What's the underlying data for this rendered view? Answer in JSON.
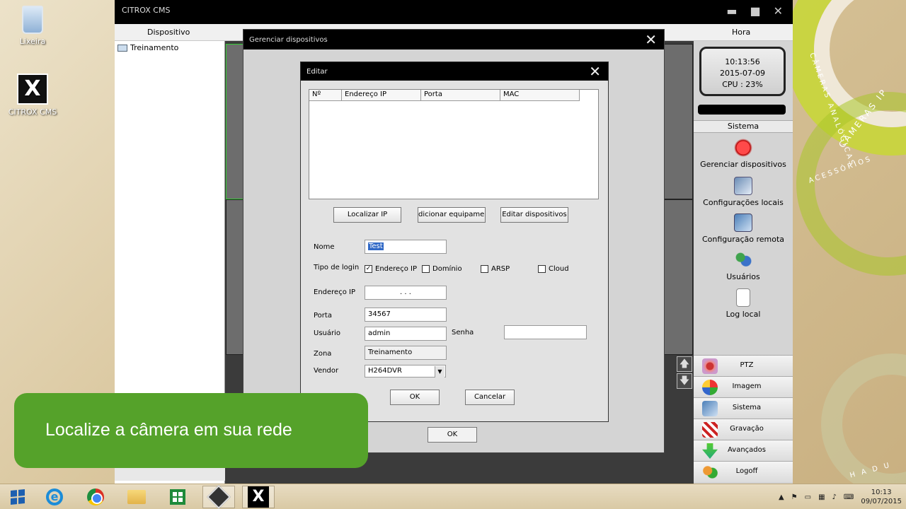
{
  "desktop": {
    "icons": [
      {
        "label": "Lixeira"
      },
      {
        "label": "CITROX CMS"
      }
    ],
    "deco_texts": [
      "CÂMERAS IP",
      "CÂMERAS ANALÓGICAS",
      "ACESSÓRIOS",
      "H A D U"
    ]
  },
  "cms": {
    "title": "CITROX CMS",
    "header_device": "Dispositivo",
    "header_time": "Hora",
    "tree_item": "Treinamento",
    "clock": {
      "time": "10:13:56",
      "date": "2015-07-09",
      "cpu": "CPU : 23%"
    },
    "system_header": "Sistema",
    "system_items": [
      {
        "label": "Gerenciar dispositivos",
        "icon": "record-red-icon"
      },
      {
        "label": "Configurações locais",
        "icon": "tools-icon"
      },
      {
        "label": "Configuração remota",
        "icon": "remote-config-icon"
      },
      {
        "label": "Usuários",
        "icon": "users-icon"
      },
      {
        "label": "Log local",
        "icon": "log-document-icon"
      }
    ],
    "bottom_menu": [
      {
        "label": "PTZ",
        "icon": "ptz-icon"
      },
      {
        "label": "Imagem",
        "icon": "image-icon"
      },
      {
        "label": "Sistema",
        "icon": "system-icon"
      },
      {
        "label": "Gravação",
        "icon": "clapper-icon"
      },
      {
        "label": "Avançados",
        "icon": "advanced-icon"
      },
      {
        "label": "Logoff",
        "icon": "logoff-icon"
      }
    ],
    "scroll_up": "🡅",
    "scroll_down": "🡇"
  },
  "gerenciar": {
    "title": "Gerenciar dispositivos",
    "ok_label": "OK"
  },
  "editar": {
    "title": "Editar",
    "columns": [
      "Nº",
      "Endereço IP",
      "Porta",
      "MAC"
    ],
    "buttons": {
      "localizar": "Localizar IP",
      "adicionar": "dicionar equipament",
      "editar": "Editar dispositivos",
      "ok": "OK",
      "cancelar": "Cancelar"
    },
    "labels": {
      "nome": "Nome",
      "tipo_login": "Tipo de login",
      "endereco_ip": "Endereço IP",
      "porta": "Porta",
      "usuario": "Usuário",
      "senha": "Senha",
      "zona": "Zona",
      "vendor": "Vendor"
    },
    "login_types": [
      {
        "label": "Endereço IP",
        "checked": true
      },
      {
        "label": "Domínio",
        "checked": false
      },
      {
        "label": "ARSP",
        "checked": false
      },
      {
        "label": "Cloud",
        "checked": false
      }
    ],
    "values": {
      "nome": "Test",
      "ip": ".      .      .",
      "porta": "34567",
      "usuario": "admin",
      "senha": "",
      "zona": "Treinamento",
      "vendor": "H264DVR"
    }
  },
  "banner": {
    "text": "Localize a câmera em sua rede"
  },
  "taskbar": {
    "time": "10:13",
    "date": "09/07/2015"
  },
  "colors": {
    "banner_green": "#55a22a",
    "title_black": "#000000",
    "selection_blue": "#3169c6"
  }
}
